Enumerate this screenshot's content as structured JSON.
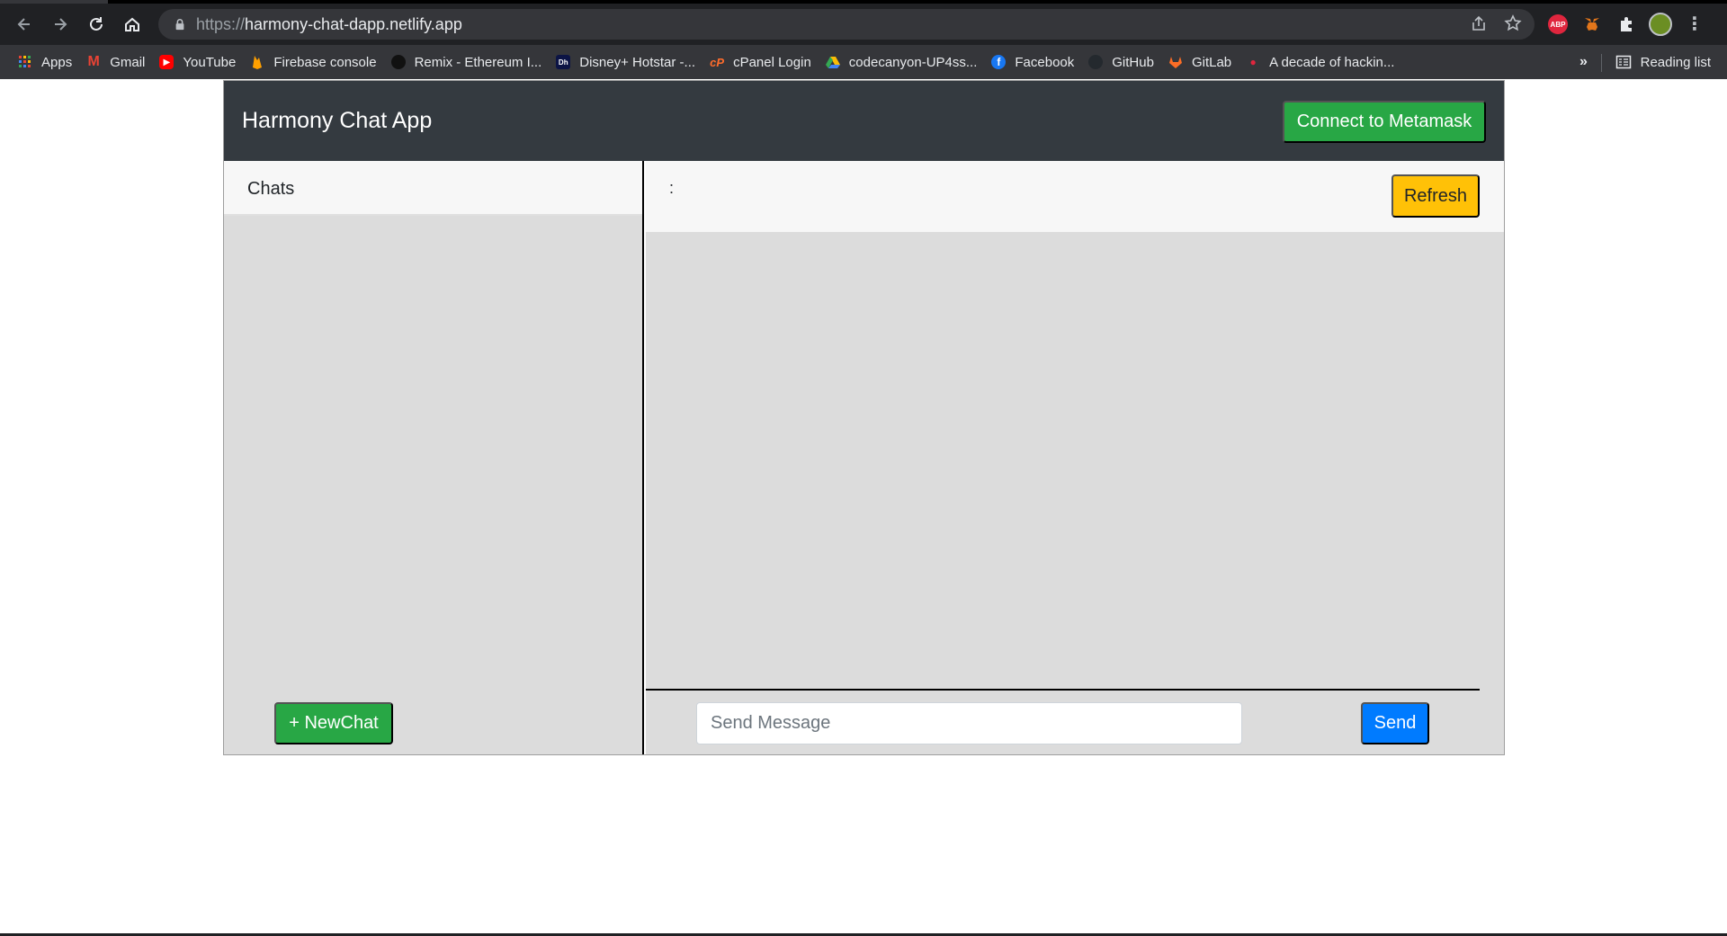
{
  "browser": {
    "url_scheme": "https://",
    "url_host": "harmony-chat-dapp.netlify.app",
    "bookmarks": [
      {
        "label": "Apps",
        "icon": "apps-grid-icon"
      },
      {
        "label": "Gmail",
        "icon": "gmail-icon"
      },
      {
        "label": "YouTube",
        "icon": "youtube-icon"
      },
      {
        "label": "Firebase console",
        "icon": "firebase-icon"
      },
      {
        "label": "Remix - Ethereum I...",
        "icon": "remix-icon"
      },
      {
        "label": "Disney+ Hotstar -...",
        "icon": "hotstar-icon"
      },
      {
        "label": "cPanel Login",
        "icon": "cpanel-icon"
      },
      {
        "label": "codecanyon-UP4ss...",
        "icon": "google-drive-icon"
      },
      {
        "label": "Facebook",
        "icon": "facebook-icon"
      },
      {
        "label": "GitHub",
        "icon": "github-icon"
      },
      {
        "label": "GitLab",
        "icon": "gitlab-icon"
      },
      {
        "label": "A decade of hackin...",
        "icon": "site-icon"
      }
    ],
    "more_bookmarks": "»",
    "reading_list": "Reading list"
  },
  "app": {
    "brand": "Harmony Chat App",
    "connect_label": "Connect to Metamask",
    "chats_title": "Chats",
    "new_chat_label": "+ NewChat",
    "chat_header_text": ":",
    "refresh_label": "Refresh",
    "message_placeholder": "Send Message",
    "send_label": "Send"
  }
}
